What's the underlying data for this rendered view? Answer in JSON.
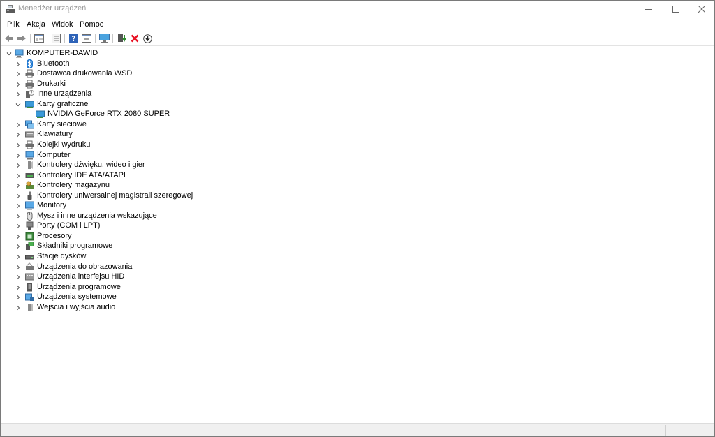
{
  "window": {
    "title": "Menedżer urządzeń"
  },
  "menu": [
    "Plik",
    "Akcja",
    "Widok",
    "Pomoc"
  ],
  "toolbar": [
    "back-icon",
    "forward-icon",
    "view-icon",
    "properties-icon",
    "help-icon",
    "show-hidden-icon",
    "scan-hardware-icon",
    "update-driver-icon",
    "uninstall-icon",
    "disable-icon"
  ],
  "tree": {
    "root": "KOMPUTER-DAWID",
    "categories": [
      {
        "label": "Bluetooth",
        "icon": "bluetooth-icon",
        "expanded": false
      },
      {
        "label": "Dostawca drukowania WSD",
        "icon": "printer-icon",
        "expanded": false
      },
      {
        "label": "Drukarki",
        "icon": "printer-icon",
        "expanded": false
      },
      {
        "label": "Inne urządzenia",
        "icon": "unknown-device-icon",
        "expanded": false
      },
      {
        "label": "Karty graficzne",
        "icon": "display-adapter-icon",
        "expanded": true,
        "children": [
          "NVIDIA GeForce RTX 2080 SUPER"
        ]
      },
      {
        "label": "Karty sieciowe",
        "icon": "network-adapter-icon",
        "expanded": false
      },
      {
        "label": "Klawiatury",
        "icon": "keyboard-icon",
        "expanded": false
      },
      {
        "label": "Kolejki wydruku",
        "icon": "print-queue-icon",
        "expanded": false
      },
      {
        "label": "Komputer",
        "icon": "computer-icon",
        "expanded": false
      },
      {
        "label": "Kontrolery dźwięku, wideo i gier",
        "icon": "sound-icon",
        "expanded": false
      },
      {
        "label": "Kontrolery IDE ATA/ATAPI",
        "icon": "ide-controller-icon",
        "expanded": false
      },
      {
        "label": "Kontrolery magazynu",
        "icon": "storage-controller-icon",
        "expanded": false
      },
      {
        "label": "Kontrolery uniwersalnej magistrali szeregowej",
        "icon": "usb-icon",
        "expanded": false
      },
      {
        "label": "Monitory",
        "icon": "monitor-icon",
        "expanded": false
      },
      {
        "label": "Mysz i inne urządzenia wskazujące",
        "icon": "mouse-icon",
        "expanded": false
      },
      {
        "label": "Porty (COM i LPT)",
        "icon": "port-icon",
        "expanded": false
      },
      {
        "label": "Procesory",
        "icon": "processor-icon",
        "expanded": false
      },
      {
        "label": "Składniki programowe",
        "icon": "software-component-icon",
        "expanded": false
      },
      {
        "label": "Stacje dysków",
        "icon": "disk-drive-icon",
        "expanded": false
      },
      {
        "label": "Urządzenia do obrazowania",
        "icon": "imaging-device-icon",
        "expanded": false
      },
      {
        "label": "Urządzenia interfejsu HID",
        "icon": "hid-icon",
        "expanded": false
      },
      {
        "label": "Urządzenia programowe",
        "icon": "software-device-icon",
        "expanded": false
      },
      {
        "label": "Urządzenia systemowe",
        "icon": "system-device-icon",
        "expanded": false
      },
      {
        "label": "Wejścia i wyjścia audio",
        "icon": "audio-io-icon",
        "expanded": false
      }
    ]
  },
  "colors": {
    "accent": "#0078d7",
    "title_inactive": "#9a9a9a",
    "uninstall_red": "#e81123",
    "update_green": "#2e8b2e"
  }
}
